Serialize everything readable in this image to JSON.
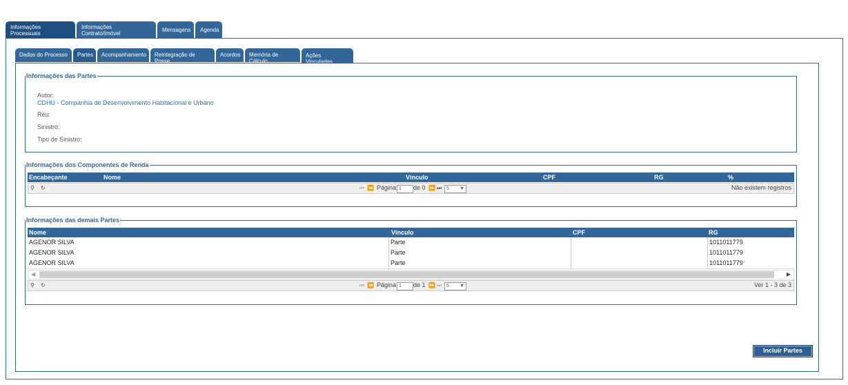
{
  "top_tabs": [
    {
      "label": "Informações Processuais"
    },
    {
      "label": "Informações Contrato/Imóvel"
    },
    {
      "label": "Mensagens"
    },
    {
      "label": "Agenda"
    }
  ],
  "sub_tabs": [
    {
      "label": "Dados do Processo"
    },
    {
      "label": "Partes"
    },
    {
      "label": "Acompanhamento"
    },
    {
      "label": "Reintegração de Posse"
    },
    {
      "label": "Acordos"
    },
    {
      "label": "Memória de Cálculo"
    },
    {
      "label": "Ações Vinculadas"
    }
  ],
  "partes": {
    "legend": "Informações das Partes",
    "autor_label": "Autor:",
    "autor_value": "CDHU - Companhia de Desenvolvimento Habitacional e Urbano",
    "reu_label": "Réu:",
    "sinistro_label": "Sinistro:",
    "tipo_sinistro_label": "Tipo de Sinistro:"
  },
  "renda": {
    "legend": "Informações dos Componentes de Renda",
    "columns": [
      "Encabeçante",
      "Nome",
      "Vínculo",
      "CPF",
      "RG",
      "%"
    ],
    "pager": {
      "page_label": "Página",
      "page_value": "1",
      "of_label": "de 0",
      "page_size": "5",
      "status": "Não existem registros"
    }
  },
  "demais": {
    "legend": "Informações das demais Partes",
    "columns": [
      "Nome",
      "Vínculo",
      "CPF",
      "RG"
    ],
    "rows": [
      {
        "nome": "AGENOR SILVA",
        "vinculo": "Parte",
        "cpf": "",
        "rg": "1011011779"
      },
      {
        "nome": "AGENOR SILVA",
        "vinculo": "Parte",
        "cpf": "",
        "rg": "1011011779"
      },
      {
        "nome": "AGENOR SILVA",
        "vinculo": "Parte",
        "cpf": "",
        "rg": "1011011779"
      }
    ],
    "pager": {
      "page_label": "Página",
      "page_value": "1",
      "of_label": "de 1",
      "page_size": "5",
      "status": "Ver 1 - 3 de 3"
    }
  },
  "actions": {
    "incluir_label": "Incluir Partes"
  },
  "icons": {
    "search": "search-icon",
    "refresh": "refresh-icon",
    "first": "first-page-icon",
    "prev": "prev-page-icon",
    "next": "next-page-icon",
    "last": "last-page-icon"
  },
  "colors": {
    "primary": "#336699",
    "link": "#1a73c8"
  }
}
